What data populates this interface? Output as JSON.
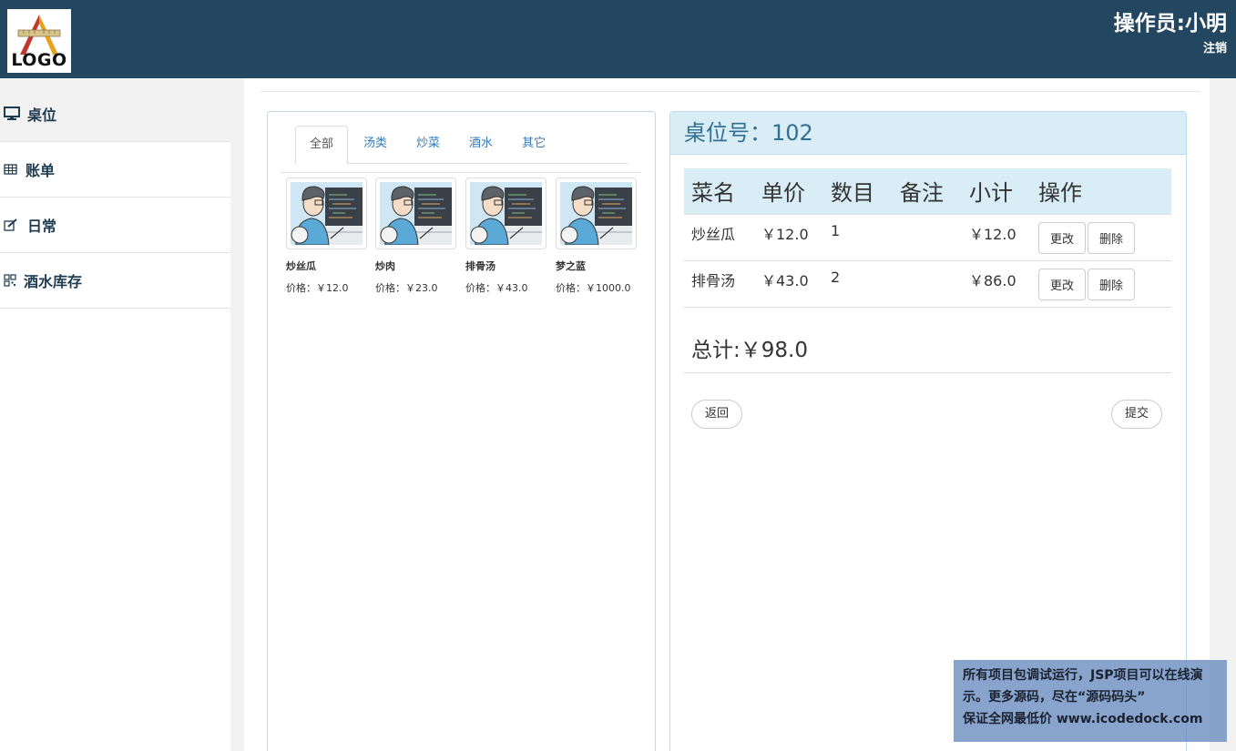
{
  "header": {
    "logo_text": "LOGO",
    "operator": "操作员:小明",
    "logout": "注销"
  },
  "sidebar": {
    "items": [
      {
        "label": "桌位",
        "icon": "monitor-icon"
      },
      {
        "label": "账单",
        "icon": "table-icon"
      },
      {
        "label": "日常",
        "icon": "edit-icon"
      },
      {
        "label": "酒水库存",
        "icon": "qrcode-icon"
      }
    ]
  },
  "menu": {
    "tabs": [
      "全部",
      "汤类",
      "炒菜",
      "酒水",
      "其它"
    ],
    "dishes": [
      {
        "name": "炒丝瓜",
        "price": "价格：￥12.0"
      },
      {
        "name": "炒肉",
        "price": "价格：￥23.0"
      },
      {
        "name": "排骨汤",
        "price": "价格：￥43.0"
      },
      {
        "name": "梦之蓝",
        "price": "价格：￥1000.0"
      }
    ]
  },
  "order": {
    "title": "桌位号：102",
    "columns": [
      "菜名",
      "单价",
      "数目",
      "备注",
      "小计",
      "操作"
    ],
    "rows": [
      {
        "name": "炒丝瓜",
        "price": "￥12.0",
        "qty": "1",
        "note": "",
        "subtotal": "￥12.0"
      },
      {
        "name": "排骨汤",
        "price": "￥43.0",
        "qty": "2",
        "note": "",
        "subtotal": "￥86.0"
      }
    ],
    "edit_label": "更改",
    "delete_label": "删除",
    "total": "总计:￥98.0",
    "back_label": "返回",
    "submit_label": "提交"
  },
  "watermark": {
    "line1": "所有项目包调试运行，JSP项目可以在线演",
    "line2": "示。更多源码，尽在“源码码头”",
    "line3": "保证全网最低价 www.icodedock.com"
  },
  "colors": {
    "header_bg": "#234760",
    "panel_head_bg": "#d9edf7",
    "link": "#337ab7"
  }
}
